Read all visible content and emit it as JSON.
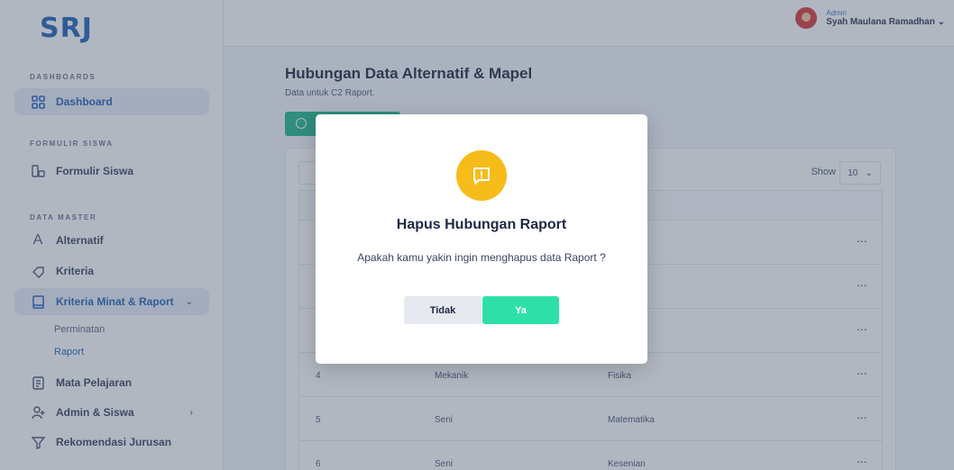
{
  "brand": {
    "logo_text": "SRJ"
  },
  "sidebar": {
    "sections": [
      {
        "label": "DASHBOARDS"
      },
      {
        "label": "FORMULIR SISWA"
      },
      {
        "label": "DATA MASTER"
      }
    ],
    "items": [
      {
        "label": "Dashboard",
        "icon": "grid-icon"
      },
      {
        "label": "Formulir Siswa",
        "icon": "form-icon"
      },
      {
        "label": "Alternatif",
        "icon": "letter-a-icon"
      },
      {
        "label": "Kriteria",
        "icon": "tag-icon"
      },
      {
        "label": "Kriteria Minat & Raport",
        "icon": "book-icon",
        "chevron": "⌄"
      },
      {
        "label": "Mata Pelajaran",
        "icon": "document-icon"
      },
      {
        "label": "Admin & Siswa",
        "icon": "user-plus-icon",
        "chevron": "›"
      },
      {
        "label": "Rekomendasi Jurusan",
        "icon": "filter-icon"
      }
    ],
    "subitems": [
      {
        "label": "Perminatan"
      },
      {
        "label": "Raport"
      }
    ]
  },
  "topbar": {
    "user_role": "Admin",
    "user_name": "Syah Maulana Ramadhan",
    "chevron": "⌄"
  },
  "main": {
    "title": "Hubungan Data Alternatif & Mapel",
    "subtitle": "Data untuk C2 Raport.",
    "show_label": "Show",
    "show_value": "10",
    "rows": [
      {
        "no": "",
        "alternatif": "",
        "mapel": ""
      },
      {
        "no": "",
        "alternatif": "",
        "mapel": ""
      },
      {
        "no": "",
        "alternatif": "",
        "mapel": "atika"
      },
      {
        "no": "4",
        "alternatif": "Mekanik",
        "mapel": "Fisika"
      },
      {
        "no": "5",
        "alternatif": "Seni",
        "mapel": "Matematika"
      },
      {
        "no": "6",
        "alternatif": "Seni",
        "mapel": "Kesenian"
      }
    ],
    "action_label": "..."
  },
  "modal": {
    "icon": "alert-message-icon",
    "title": "Hapus Hubungan Raport",
    "message": "Apakah kamu yakin ingin menghapus data Raport ?",
    "no_label": "Tidak",
    "yes_label": "Ya"
  },
  "colors": {
    "accent": "#1f63b8",
    "success": "#2ee0a8",
    "warning": "#f5bc1a"
  }
}
